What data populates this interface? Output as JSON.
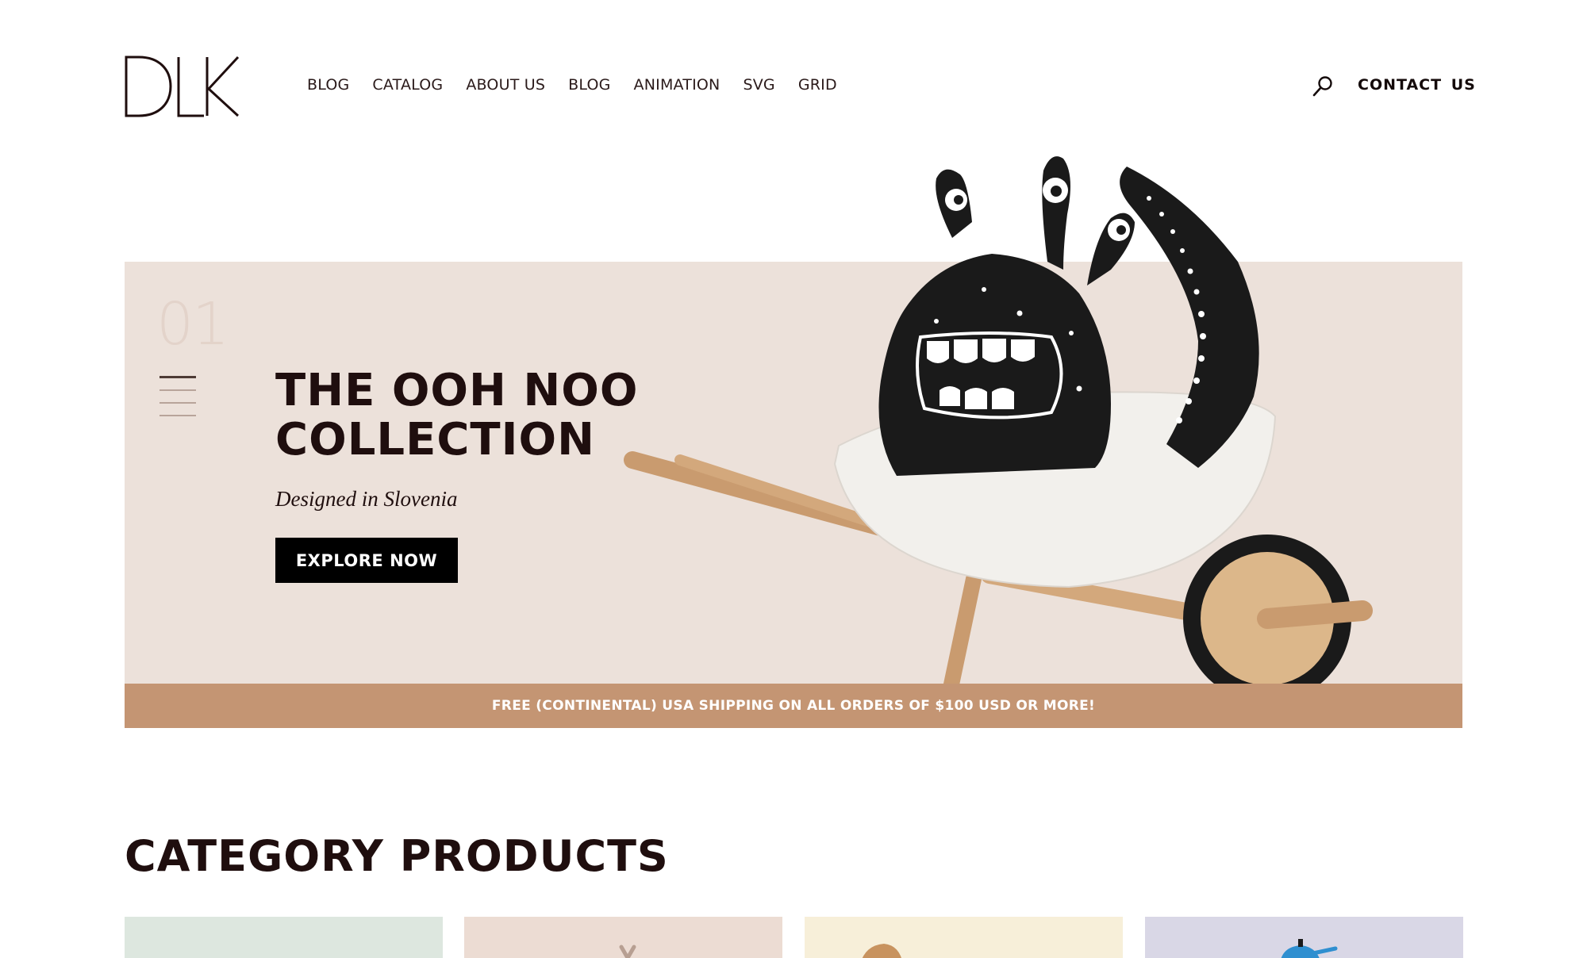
{
  "brand": {
    "logo_text": "DLK"
  },
  "nav": {
    "items": [
      {
        "label": "BLOG"
      },
      {
        "label": "CATALOG"
      },
      {
        "label": "ABOUT US"
      },
      {
        "label": "BLOG"
      },
      {
        "label": "ANIMATION"
      },
      {
        "label": "SVG"
      },
      {
        "label": "GRID"
      }
    ]
  },
  "header": {
    "search_icon": "search-icon",
    "contact_label": "CONTACT US"
  },
  "hero": {
    "slide_number": "01",
    "slide_count_lines": 4,
    "title": "THE OOH NOO\nCOLLECTION",
    "subtitle": "Designed in Slovenia",
    "cta_label": "EXPLORE NOW",
    "background_color": "#ece1da"
  },
  "shipping_banner": {
    "text": "FREE (CONTINENTAL) USA SHIPPING ON ALL ORDERS OF $100 USD OR MORE!",
    "color": "#c49573"
  },
  "category": {
    "title": "CATEGORY PRODUCTS",
    "cards": [
      {
        "bg": "#dde7df"
      },
      {
        "bg": "#ecdcd3"
      },
      {
        "bg": "#f7efd9"
      },
      {
        "bg": "#d9d7e6"
      }
    ]
  }
}
